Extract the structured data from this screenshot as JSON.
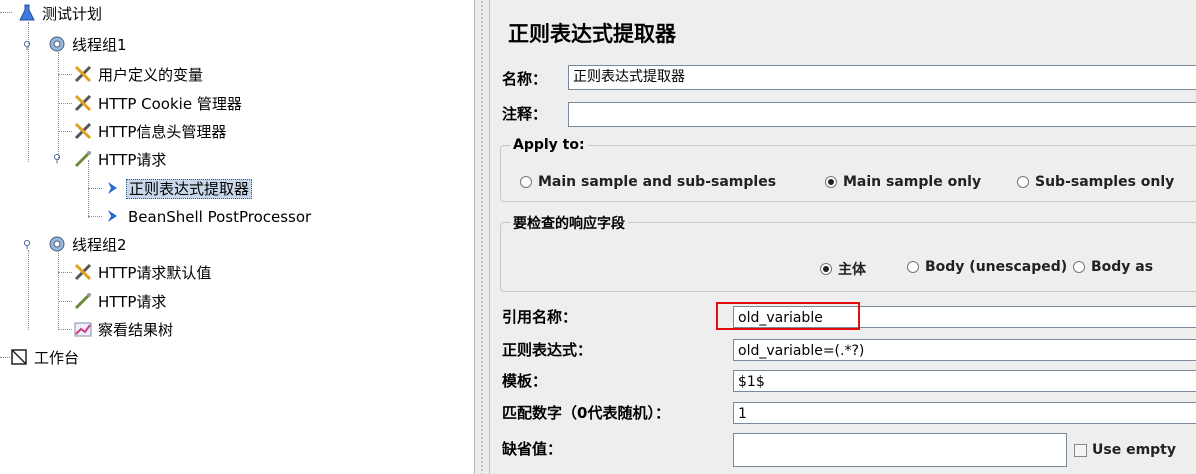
{
  "tree": {
    "items": [
      {
        "label": "测试计划",
        "icon": "flask-icon"
      },
      {
        "label": "线程组1",
        "icon": "gear-icon"
      },
      {
        "label": "用户定义的变量",
        "icon": "wrench-icon"
      },
      {
        "label": "HTTP Cookie 管理器",
        "icon": "wrench-icon"
      },
      {
        "label": "HTTP信息头管理器",
        "icon": "wrench-icon"
      },
      {
        "label": "HTTP请求",
        "icon": "pipette-icon"
      },
      {
        "label": "正则表达式提取器",
        "icon": "arrow-icon"
      },
      {
        "label": "BeanShell PostProcessor",
        "icon": "arrow-icon"
      },
      {
        "label": "线程组2",
        "icon": "gear-icon"
      },
      {
        "label": "HTTP请求默认值",
        "icon": "wrench-icon"
      },
      {
        "label": "HTTP请求",
        "icon": "pipette-icon"
      },
      {
        "label": "察看结果树",
        "icon": "chart-icon"
      },
      {
        "label": "工作台",
        "icon": "workbench-icon"
      }
    ],
    "selected": "正则表达式提取器"
  },
  "panel": {
    "title": "正则表达式提取器",
    "name_label": "名称：",
    "name_value": "正则表达式提取器",
    "comment_label": "注释：",
    "comment_value": "",
    "apply_to": {
      "title": "Apply to:",
      "options": [
        "Main sample and sub-samples",
        "Main sample only",
        "Sub-samples only"
      ],
      "selected": "Main sample only"
    },
    "response_field": {
      "title": "要检查的响应字段",
      "options": [
        "主体",
        "Body (unescaped)",
        "Body as"
      ],
      "selected": "主体"
    },
    "ref_name_label": "引用名称：",
    "ref_name_value": "old_variable",
    "regex_label": "正则表达式：",
    "regex_value": "old_variable=(.*?)",
    "template_label": "模板：",
    "template_value": "$1$",
    "match_no_label": "匹配数字（0代表随机）：",
    "match_no_value": "1",
    "default_label": "缺省值：",
    "default_value": "",
    "use_empty_label": "Use empty"
  },
  "colors": {
    "highlight": "#e01010",
    "selection": "#c9d7ea",
    "panel_bg": "#eeeeee"
  }
}
